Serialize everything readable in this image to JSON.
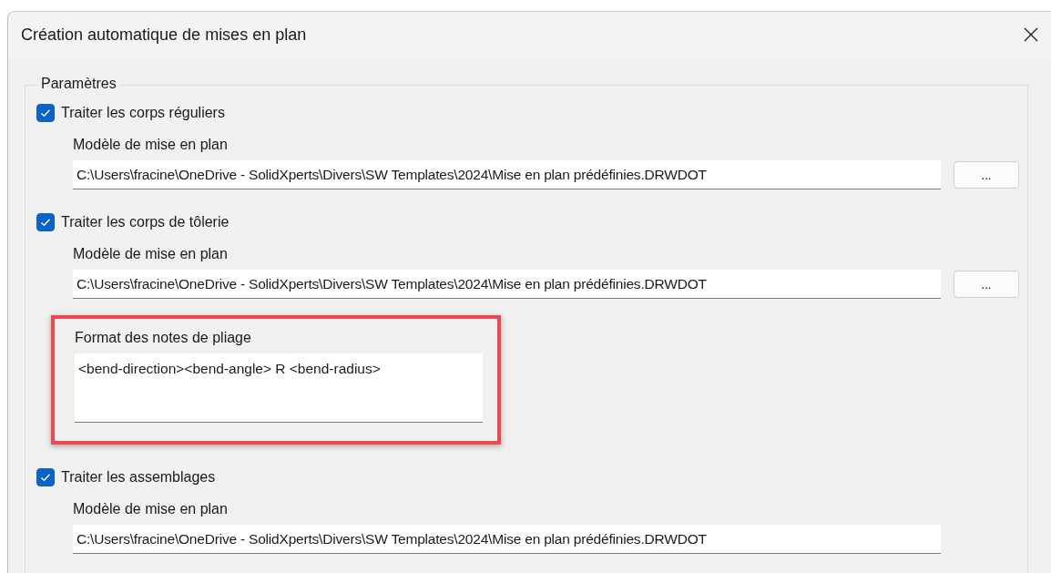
{
  "window": {
    "title": "Création automatique de mises en plan"
  },
  "group": {
    "title": "Paramètres"
  },
  "sections": [
    {
      "label": "Traiter les corps réguliers",
      "checked": true,
      "template_label": "Modèle de mise en plan",
      "template_path": "C:\\Users\\fracine\\OneDrive - SolidXperts\\Divers\\SW Templates\\2024\\Mise en plan prédéfinies.DRWDOT",
      "browse": "..."
    },
    {
      "label": "Traiter les corps de tôlerie",
      "checked": true,
      "template_label": "Modèle de mise en plan",
      "template_path": "C:\\Users\\fracine\\OneDrive - SolidXperts\\Divers\\SW Templates\\2024\\Mise en plan prédéfinies.DRWDOT",
      "browse": "...",
      "bend_notes": {
        "label": "Format des notes de pliage",
        "value": "<bend-direction><bend-angle> R <bend-radius>",
        "highlighted": true
      }
    },
    {
      "label": "Traiter les assemblages",
      "checked": true,
      "template_label": "Modèle de mise en plan",
      "template_path": "C:\\Users\\fracine\\OneDrive - SolidXperts\\Divers\\SW Templates\\2024\\Mise en plan prédéfinies.DRWDOT"
    }
  ]
}
